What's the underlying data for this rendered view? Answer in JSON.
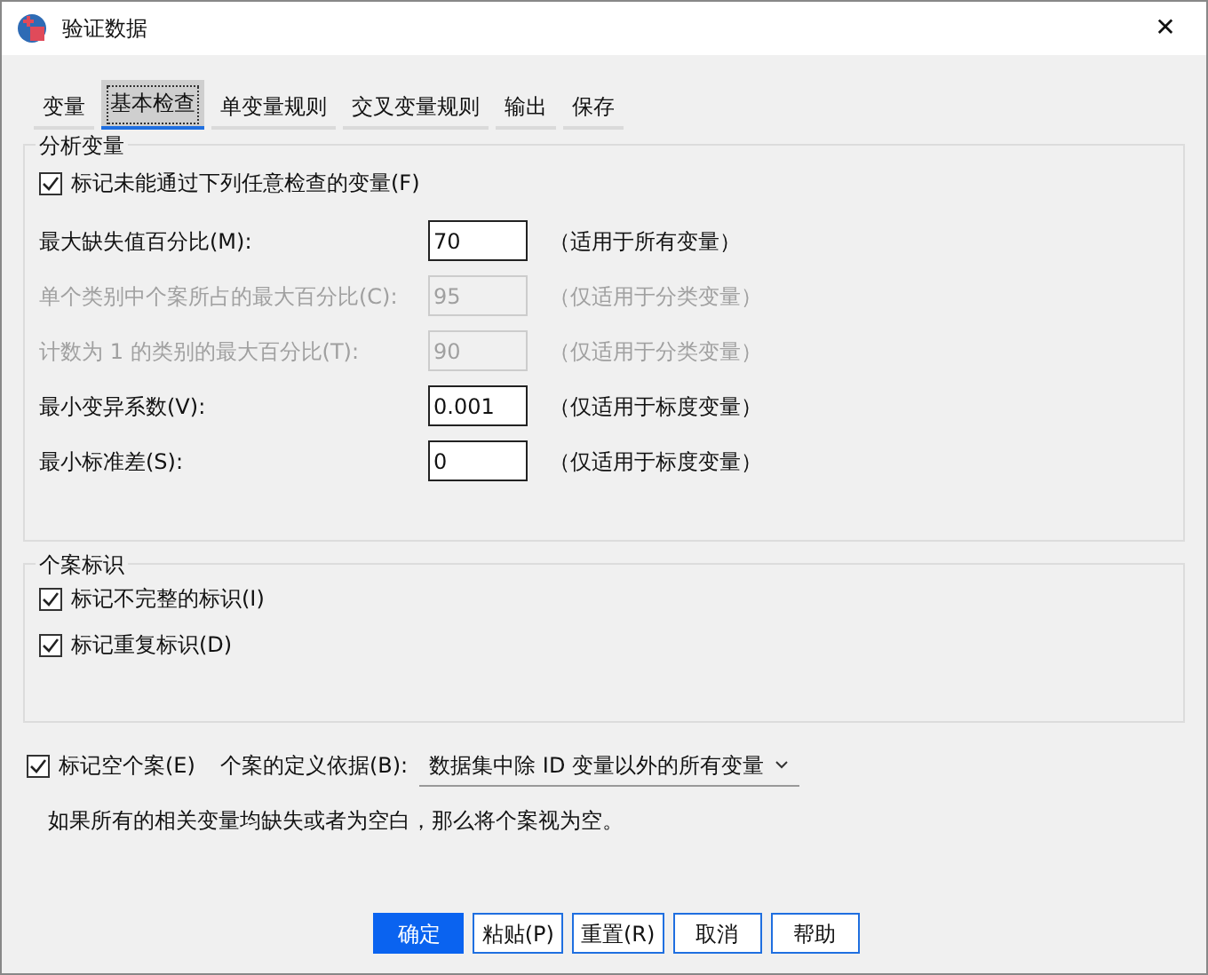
{
  "window": {
    "title": "验证数据",
    "close": "✕"
  },
  "tabs": [
    {
      "label": "变量",
      "selected": false
    },
    {
      "label": "基本检查",
      "selected": true
    },
    {
      "label": "单变量规则",
      "selected": false
    },
    {
      "label": "交叉变量规则",
      "selected": false
    },
    {
      "label": "输出",
      "selected": false
    },
    {
      "label": "保存",
      "selected": false
    }
  ],
  "analysis_group": {
    "title": "分析变量",
    "flag": {
      "label": "标记未能通过下列任意检查的变量(F)",
      "checked": true
    },
    "rows": [
      {
        "label": "最大缺失值百分比(M):",
        "value": "70",
        "note": "（适用于所有变量）",
        "disabled": false
      },
      {
        "label": "单个类别中个案所占的最大百分比(C):",
        "value": "95",
        "note": "（仅适用于分类变量）",
        "disabled": true
      },
      {
        "label": "计数为 1 的类别的最大百分比(T):",
        "value": "90",
        "note": "（仅适用于分类变量）",
        "disabled": true
      },
      {
        "label": "最小变异系数(V):",
        "value": "0.001",
        "note": "（仅适用于标度变量）",
        "disabled": false
      },
      {
        "label": "最小标准差(S):",
        "value": "0",
        "note": "（仅适用于标度变量）",
        "disabled": false
      }
    ]
  },
  "case_group": {
    "title": "个案标识",
    "checks": [
      {
        "label": "标记不完整的标识(I)",
        "checked": true
      },
      {
        "label": "标记重复标识(D)",
        "checked": true
      }
    ]
  },
  "empty_cases": {
    "label": "标记空个案(E)",
    "checked": true,
    "basis_label": "个案的定义依据(B):",
    "basis_value": "数据集中除 ID 变量以外的所有变量"
  },
  "note": "如果所有的相关变量均缺失或者为空白，那么将个案视为空。",
  "buttons": [
    {
      "label": "确定",
      "primary": true
    },
    {
      "label": "粘贴(P)",
      "primary": false
    },
    {
      "label": "重置(R)",
      "primary": false
    },
    {
      "label": "取消",
      "primary": false
    },
    {
      "label": "帮助",
      "primary": false
    }
  ]
}
